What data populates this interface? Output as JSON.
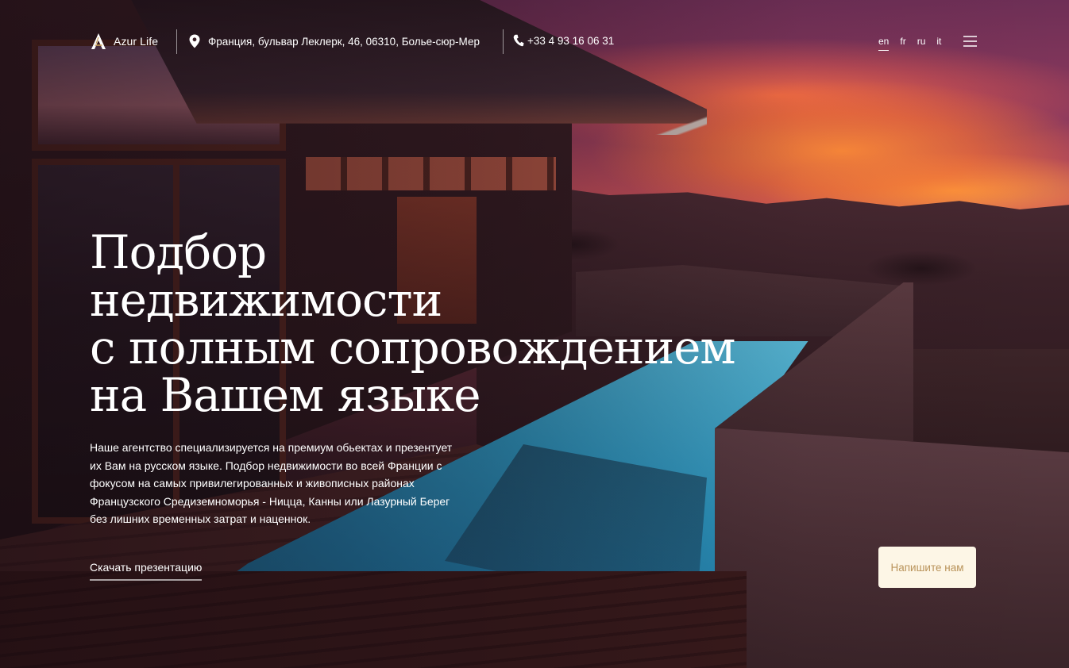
{
  "header": {
    "logo_text": "Azur Life",
    "address": "Франция, бульвар Леклерк, 46, 06310, Болье-сюр-Мер",
    "phone": "+33 4 93 16 06 31",
    "languages": [
      {
        "code": "en",
        "active": true
      },
      {
        "code": "fr",
        "active": false
      },
      {
        "code": "ru",
        "active": false
      },
      {
        "code": "it",
        "active": false
      }
    ],
    "icons": {
      "logo": "azur-life-logo",
      "address": "map-pin-icon",
      "phone": "phone-icon",
      "menu": "hamburger-menu-icon"
    }
  },
  "hero": {
    "title_lines": [
      "Подбор",
      "недвижимости",
      "с полным сопровождением",
      "на Вашем языке"
    ],
    "description_lines": [
      "Наше агентство специализируется на премиум обьектах и презентует",
      "их Вам на русском языке. Подбор недвижимости во всей Франции с",
      "фокусом на самых привилегированных и живописных районах",
      "Французского Средиземноморья - Ницца, Канны или Лазурный Берег",
      "без лишних временных затрат и наценнок."
    ],
    "download_label": "Скачать презентацию",
    "contact_label": "Напишите нам"
  },
  "colors": {
    "contact_button_bg": "#fdf6e6",
    "contact_button_text": "#b9935a",
    "text": "#ffffff"
  }
}
